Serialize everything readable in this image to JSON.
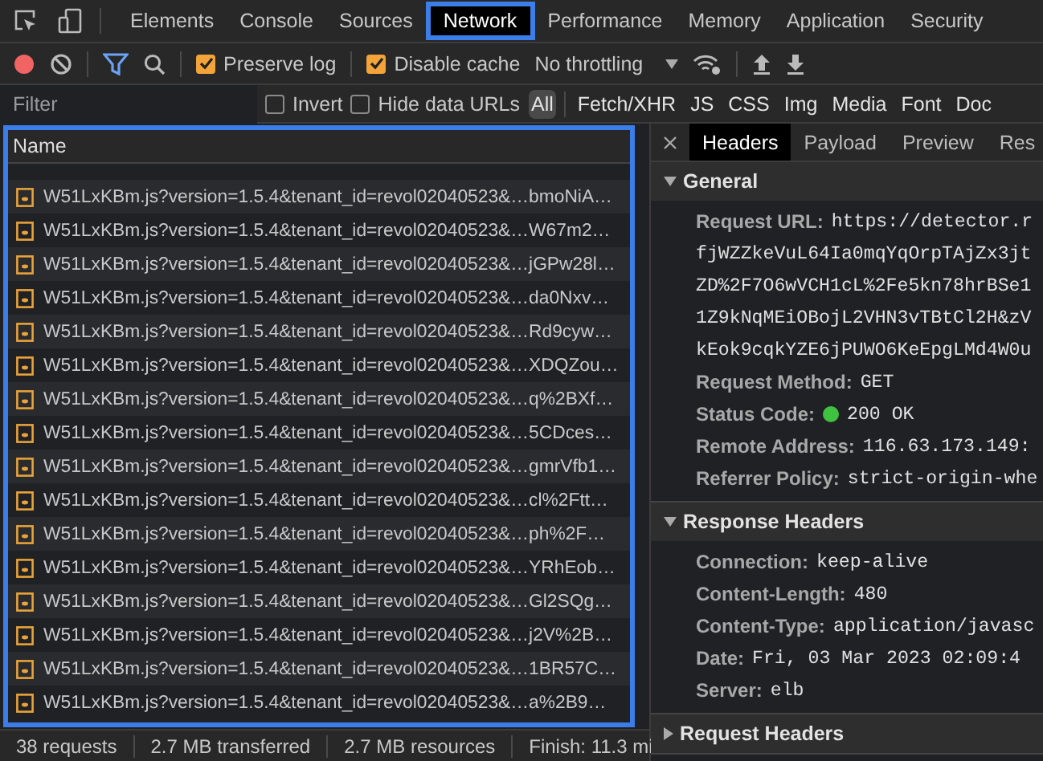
{
  "main_tabs": [
    {
      "label": "Elements",
      "selected": false
    },
    {
      "label": "Console",
      "selected": false
    },
    {
      "label": "Sources",
      "selected": false
    },
    {
      "label": "Network",
      "selected": true
    },
    {
      "label": "Performance",
      "selected": false
    },
    {
      "label": "Memory",
      "selected": false
    },
    {
      "label": "Application",
      "selected": false
    },
    {
      "label": "Security",
      "selected": false
    }
  ],
  "network_toolbar": {
    "preserve_log": {
      "label": "Preserve log",
      "checked": true
    },
    "disable_cache": {
      "label": "Disable cache",
      "checked": true
    },
    "throttling": "No throttling"
  },
  "filter_bar": {
    "placeholder": "Filter",
    "invert": {
      "label": "Invert",
      "checked": false
    },
    "hide_data_urls": {
      "label": "Hide data URLs",
      "checked": false
    },
    "types": [
      {
        "label": "All",
        "selected": true
      },
      {
        "label": "Fetch/XHR",
        "selected": false
      },
      {
        "label": "JS",
        "selected": false
      },
      {
        "label": "CSS",
        "selected": false
      },
      {
        "label": "Img",
        "selected": false
      },
      {
        "label": "Media",
        "selected": false
      },
      {
        "label": "Font",
        "selected": false
      },
      {
        "label": "Doc",
        "selected": false
      }
    ]
  },
  "request_list": {
    "column": "Name",
    "rows": [
      "W51LxKBm.js?version=1.5.4&tenant_id=revol02040523&…bmoNiA…",
      "W51LxKBm.js?version=1.5.4&tenant_id=revol02040523&…W67m2…",
      "W51LxKBm.js?version=1.5.4&tenant_id=revol02040523&…jGPw28l…",
      "W51LxKBm.js?version=1.5.4&tenant_id=revol02040523&…da0Nxv…",
      "W51LxKBm.js?version=1.5.4&tenant_id=revol02040523&…Rd9cyw…",
      "W51LxKBm.js?version=1.5.4&tenant_id=revol02040523&…XDQZou…",
      "W51LxKBm.js?version=1.5.4&tenant_id=revol02040523&…q%2BXf…",
      "W51LxKBm.js?version=1.5.4&tenant_id=revol02040523&…5CDces…",
      "W51LxKBm.js?version=1.5.4&tenant_id=revol02040523&…gmrVfb1…",
      "W51LxKBm.js?version=1.5.4&tenant_id=revol02040523&…cl%2Ftt…",
      "W51LxKBm.js?version=1.5.4&tenant_id=revol02040523&…ph%2F…",
      "W51LxKBm.js?version=1.5.4&tenant_id=revol02040523&…YRhEob…",
      "W51LxKBm.js?version=1.5.4&tenant_id=revol02040523&…Gl2SQg…",
      "W51LxKBm.js?version=1.5.4&tenant_id=revol02040523&…j2V%2B…",
      "W51LxKBm.js?version=1.5.4&tenant_id=revol02040523&…1BR57C…",
      "W51LxKBm.js?version=1.5.4&tenant_id=revol02040523&…a%2B9…"
    ]
  },
  "status_bar": [
    "38 requests",
    "2.7 MB transferred",
    "2.7 MB resources",
    "Finish: 11.3 mi"
  ],
  "detail_tabs": [
    {
      "label": "Headers",
      "selected": true
    },
    {
      "label": "Payload",
      "selected": false
    },
    {
      "label": "Preview",
      "selected": false
    },
    {
      "label": "Res",
      "selected": false
    }
  ],
  "sections": [
    {
      "title": "General",
      "expanded": true,
      "items": [
        {
          "key": "Request URL:",
          "lines": [
            "https://detector.r",
            "fjWZZkeVuL64Ia0mqYqOrpTAjZx3jt",
            "ZD%2F7O6wVCH1cL%2Fe5kn78hrBSe1",
            "1Z9kNqMEiOBojL2VHN3vTBtCl2H&zV",
            "kEok9cqkYZE6jPUWO6KeEpgLMd4W0u"
          ]
        },
        {
          "key": "Request Method:",
          "lines": [
            "GET"
          ]
        },
        {
          "key": "Status Code:",
          "lines": [
            "200 OK"
          ],
          "kind": "status"
        },
        {
          "key": "Remote Address:",
          "lines": [
            "116.63.173.149:"
          ]
        },
        {
          "key": "Referrer Policy:",
          "lines": [
            "strict-origin-whe"
          ]
        }
      ]
    },
    {
      "title": "Response Headers",
      "expanded": true,
      "items": [
        {
          "key": "Connection:",
          "lines": [
            "keep-alive"
          ]
        },
        {
          "key": "Content-Length:",
          "lines": [
            "480"
          ]
        },
        {
          "key": "Content-Type:",
          "lines": [
            "application/javasc"
          ]
        },
        {
          "key": "Date:",
          "lines": [
            "Fri, 03 Mar 2023 02:09:4"
          ]
        },
        {
          "key": "Server:",
          "lines": [
            "elb"
          ]
        }
      ]
    },
    {
      "title": "Request Headers",
      "expanded": false
    }
  ]
}
